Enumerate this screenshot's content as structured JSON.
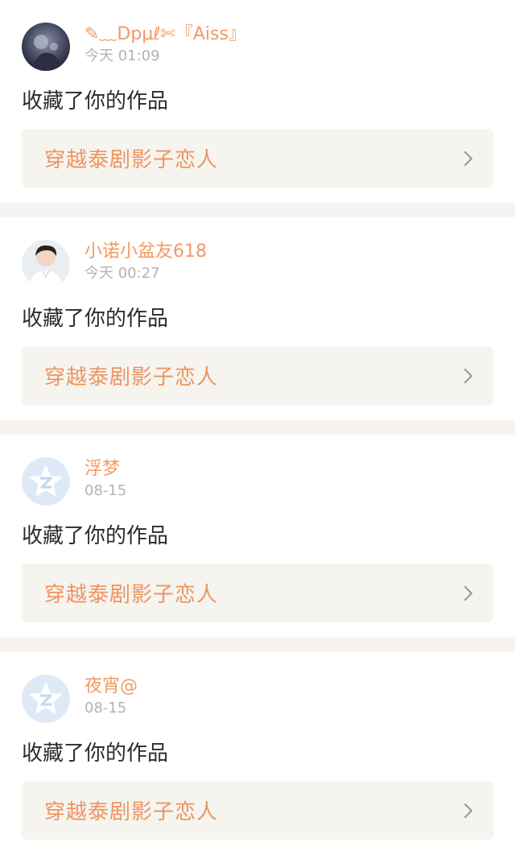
{
  "colors": {
    "username": "#f29a62",
    "time": "#b3b3b3",
    "action_text": "#2b2b2b",
    "work_title": "#ef9460",
    "work_bg": "#f5f4ef",
    "separator": "#f6f3f1"
  },
  "feed": [
    {
      "username": "✎﹏Dpμℓ✄『Aiss』",
      "time": "今天 01:09",
      "action": "收藏了你的作品",
      "work_title": "穿越泰剧影子恋人",
      "avatar": "photo-avatar-dark",
      "chevron": "chevron-right-icon"
    },
    {
      "username": "小诺小盆友618",
      "time": "今天 00:27",
      "action": "收藏了你的作品",
      "work_title": "穿越泰剧影子恋人",
      "avatar": "photo-avatar-boy",
      "chevron": "chevron-right-icon"
    },
    {
      "username": "浮梦",
      "time": "08-15",
      "action": "收藏了你的作品",
      "work_title": "穿越泰剧影子恋人",
      "avatar": "default-star-avatar",
      "chevron": "chevron-right-icon"
    },
    {
      "username": "夜宵@",
      "time": "08-15",
      "action": "收藏了你的作品",
      "work_title": "穿越泰剧影子恋人",
      "avatar": "default-star-avatar",
      "chevron": "chevron-right-icon"
    }
  ]
}
